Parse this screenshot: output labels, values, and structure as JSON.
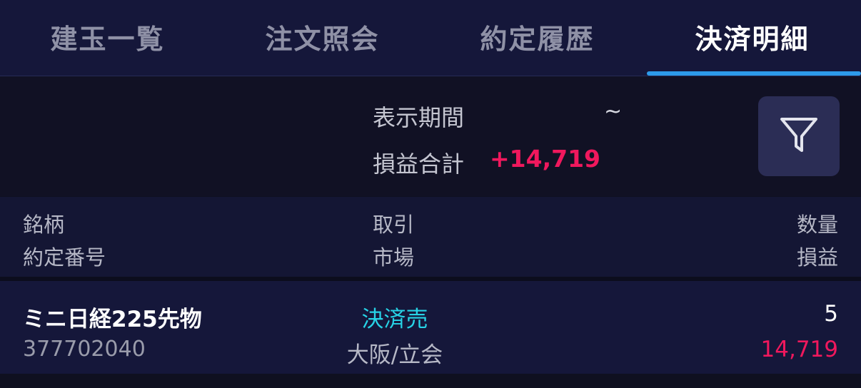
{
  "tabs": [
    {
      "label": "建玉一覧"
    },
    {
      "label": "注文照会"
    },
    {
      "label": "約定履歴"
    },
    {
      "label": "決済明細"
    }
  ],
  "active_tab_index": 3,
  "colors": {
    "accent": "#2d9bea",
    "profit": "#f0185d",
    "trade_type": "#27d3e6",
    "background": "#0f1020"
  },
  "summary": {
    "period_label": "表示期間",
    "period_separator": "~",
    "pl_label": "損益合計",
    "pl_total": "+14,719",
    "filter_icon": "filter-icon"
  },
  "columns": {
    "symbol": "銘柄",
    "contract_no": "約定番号",
    "trade": "取引",
    "market": "市場",
    "quantity": "数量",
    "pl": "損益"
  },
  "rows": [
    {
      "symbol": "ミニ日経225先物",
      "contract_no": "377702040",
      "trade_type": "決済売",
      "market": "大阪/立会",
      "quantity": "5",
      "pl": "14,719"
    }
  ]
}
